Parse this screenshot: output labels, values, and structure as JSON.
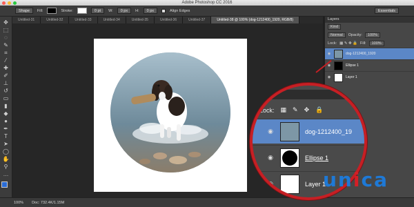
{
  "window": {
    "title": "Adobe Photoshop CC 2016"
  },
  "options_bar": {
    "shape_mode": "Shape",
    "fill_label": "Fill:",
    "stroke_label": "Stroke:",
    "stroke_width": "0 pt",
    "w_label": "W:",
    "w_value": "0 px",
    "h_label": "H:",
    "h_value": "0 px",
    "align_edges": "Align Edges",
    "workspace": "Essentials"
  },
  "tabs": [
    {
      "label": "Untitled-31"
    },
    {
      "label": "Untitled-32"
    },
    {
      "label": "Untitled-33"
    },
    {
      "label": "Untitled-34"
    },
    {
      "label": "Untitled-35"
    },
    {
      "label": "Untitled-36"
    },
    {
      "label": "Untitled-37"
    },
    {
      "label": "Untitled-38 @ 100% (dog-1212400_1920, RGB/8)"
    }
  ],
  "status_bar": {
    "zoom": "100%",
    "doc_info": "Doc: 732.4K/1.15M"
  },
  "layers_panel": {
    "title": "Layers",
    "filter_kind": "Kind",
    "blend_mode": "Normal",
    "opacity_label": "Opacity:",
    "opacity_value": "100%",
    "lock_label": "Lock:",
    "fill_label": "Fill:",
    "fill_value": "100%",
    "layers": [
      {
        "name": "dog-1212400_1920"
      },
      {
        "name": "Ellipse 1"
      },
      {
        "name": "Layer 1"
      }
    ]
  },
  "magnifier": {
    "header": "ers",
    "lock_label": "Lock:",
    "layers": [
      {
        "name": "dog-1212400_19"
      },
      {
        "name": "Ellipse 1"
      },
      {
        "name": "Layer 1"
      }
    ]
  },
  "watermark": {
    "part1": "un",
    "part2": "i",
    "part3": "ca"
  },
  "colors": {
    "accent_red": "#c61f24",
    "selection_blue": "#5b87c7",
    "foreground": "#2a6cd6"
  }
}
